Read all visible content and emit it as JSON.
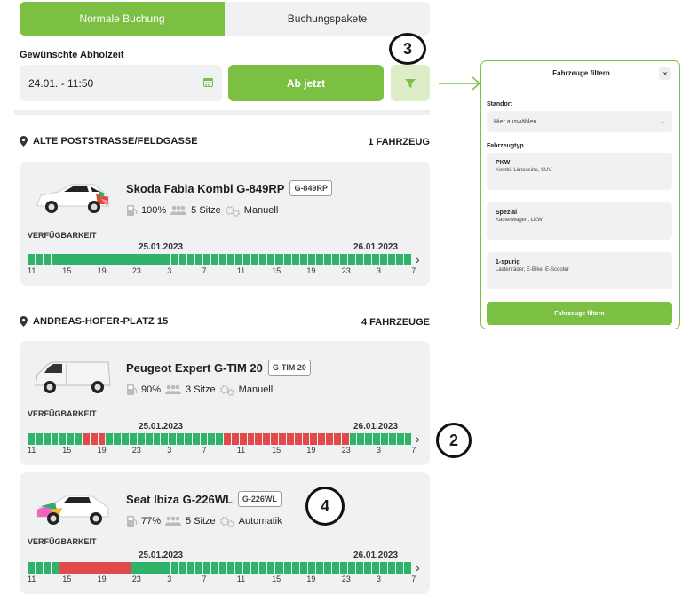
{
  "tabs": {
    "normal": "Normale Buchung",
    "pakete": "Buchungspakete"
  },
  "pickup": {
    "label": "Gewünschte Abholzeit",
    "value": "24.01. - 11:50",
    "now_button": "Ab jetzt"
  },
  "colors": {
    "green": "#7bc043",
    "avail": "#2fb36a",
    "busy": "#e04a4a"
  },
  "annotations": {
    "a2": "2",
    "a3": "3",
    "a4": "4"
  },
  "timeline": {
    "verf": "VERFÜGBARKEIT",
    "date1": "25.01.2023",
    "date2": "26.01.2023",
    "ticks": [
      "11",
      "15",
      "19",
      "23",
      "3",
      "7",
      "11",
      "15",
      "19",
      "23",
      "3",
      "7"
    ]
  },
  "locations": [
    {
      "name": "ALTE POSTSTRASSE/FELDGASSE",
      "count": "1 FAHRZEUG",
      "cars": [
        {
          "name": "Skoda Fabia Kombi G-849RP",
          "plate": "G-849RP",
          "fuel": "100%",
          "seats": "5 Sitze",
          "gear": "Manuell",
          "bars": "gggggggggggggggggggggggggggggggggggggggggggggggg"
        }
      ]
    },
    {
      "name": "ANDREAS-HOFER-PLATZ 15",
      "count": "4 FAHRZEUGE",
      "cars": [
        {
          "name": "Peugeot Expert G-TIM 20",
          "plate": "G-TIM 20",
          "fuel": "90%",
          "seats": "3 Sitze",
          "gear": "Manuell",
          "bars": "gggggggrrrgggggggggggggggrrrrrrrrrrrrrrrrgggggggg"
        },
        {
          "name": "Seat Ibiza G-226WL",
          "plate": "G-226WL",
          "fuel": "77%",
          "seats": "5 Sitze",
          "gear": "Automatik",
          "bars": "ggggrrrrrrrrrggggggggggggggggggggggggggggggggggg"
        }
      ]
    }
  ],
  "filter_panel": {
    "title": "Fahrzeuge filtern",
    "close": "×",
    "standort_label": "Standort",
    "standort_placeholder": "Hier auswählen",
    "type_label": "Fahrzeugtyp",
    "options": [
      {
        "title": "PKW",
        "sub": "Kombi, Limousine, SUV"
      },
      {
        "title": "Spezial",
        "sub": "Kastenwagen, LKW"
      },
      {
        "title": "1-spurig",
        "sub": "Lastenräder, E-Bike, E-Scooter"
      }
    ],
    "apply": "Fahrzeuge filtern"
  }
}
